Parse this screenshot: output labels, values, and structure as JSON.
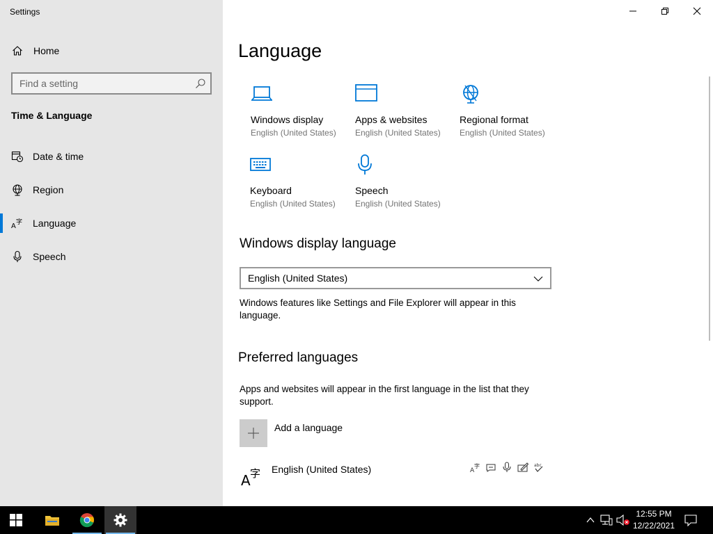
{
  "app": {
    "title": "Settings"
  },
  "sidebar": {
    "home_label": "Home",
    "search_placeholder": "Find a setting",
    "section_title": "Time & Language",
    "items": [
      {
        "label": "Date & time",
        "icon": "calendar-clock-icon"
      },
      {
        "label": "Region",
        "icon": "globe-icon"
      },
      {
        "label": "Language",
        "icon": "language-icon",
        "active": true
      },
      {
        "label": "Speech",
        "icon": "microphone-icon"
      }
    ]
  },
  "main": {
    "title": "Language",
    "tiles": [
      {
        "title": "Windows display",
        "subtitle": "English (United States)",
        "icon": "monitor-icon"
      },
      {
        "title": "Apps & websites",
        "subtitle": "English (United States)",
        "icon": "browser-window-icon"
      },
      {
        "title": "Regional format",
        "subtitle": "English (United States)",
        "icon": "globe-clock-icon"
      },
      {
        "title": "Keyboard",
        "subtitle": "English (United States)",
        "icon": "keyboard-icon"
      },
      {
        "title": "Speech",
        "subtitle": "English (United States)",
        "icon": "microphone-icon"
      }
    ],
    "display_language": {
      "heading": "Windows display language",
      "selected": "English (United States)",
      "description": "Windows features like Settings and File Explorer will appear in this language."
    },
    "preferred": {
      "heading": "Preferred languages",
      "description": "Apps and websites will appear in the first language in the list that they support.",
      "add_label": "Add a language",
      "languages": [
        {
          "name": "English (United States)"
        }
      ]
    }
  },
  "taskbar": {
    "time": "12:55 PM",
    "date": "12/22/2021"
  },
  "colors": {
    "accent": "#0078d7",
    "sidebar_bg": "#e6e6e6",
    "taskbar_bg": "#000000"
  }
}
